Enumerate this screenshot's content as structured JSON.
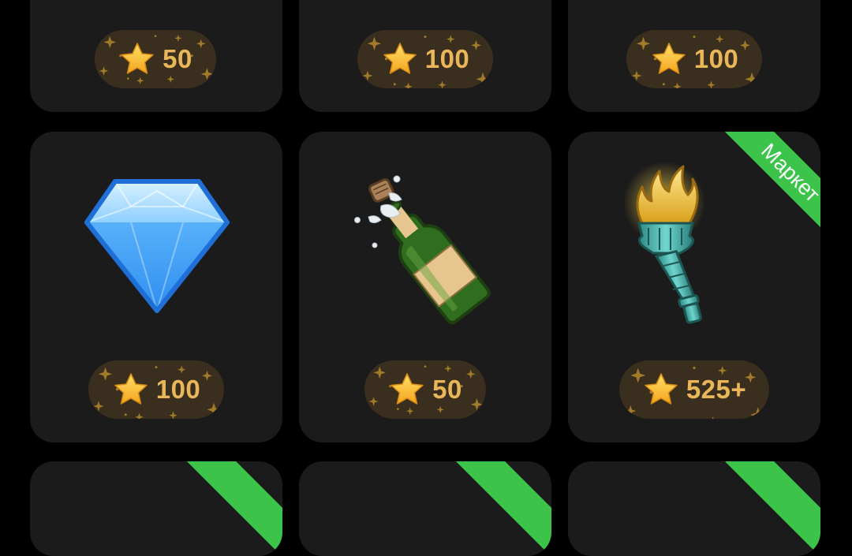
{
  "rows": [
    {
      "cards": [
        {
          "name": "gift-card-1",
          "price": "50"
        },
        {
          "name": "gift-card-2",
          "price": "100"
        },
        {
          "name": "gift-card-3",
          "price": "100"
        }
      ]
    },
    {
      "cards": [
        {
          "name": "gift-card-diamond",
          "icon": "diamond-icon",
          "price": "100"
        },
        {
          "name": "gift-card-champagne",
          "icon": "champagne-icon",
          "price": "50"
        },
        {
          "name": "gift-card-torch",
          "icon": "torch-icon",
          "price": "525+",
          "badge": "Маркет"
        }
      ]
    }
  ],
  "colors": {
    "background": "#000000",
    "card": "#1b1b1b",
    "price_pill": "#3a2f1e",
    "price_text": "#e9b75a",
    "badge": "#3cc44a"
  }
}
